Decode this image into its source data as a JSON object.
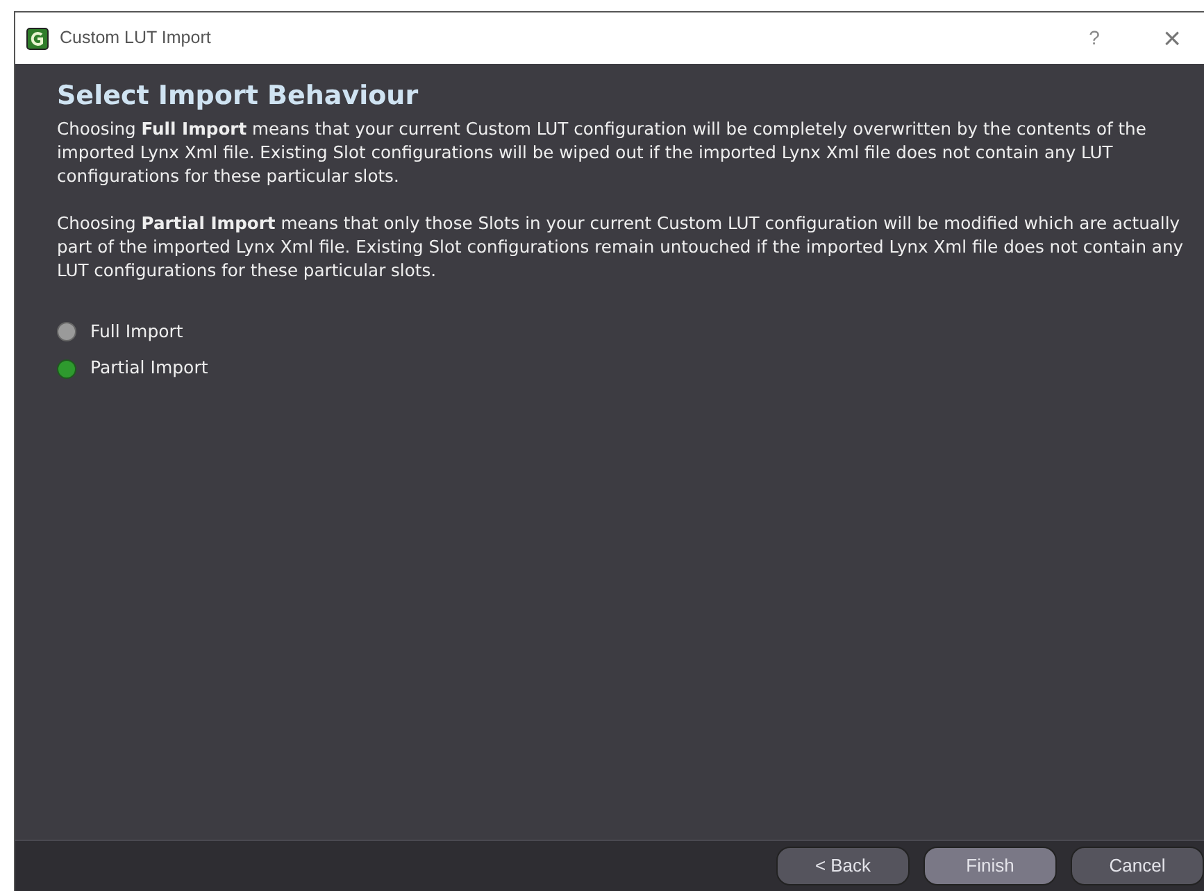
{
  "window": {
    "title": "Custom LUT Import",
    "help": "?",
    "close": "×"
  },
  "heading": "Select Import Behaviour",
  "paragraphs": [
    "Choosing **Full Import** means that your current Custom LUT configuration will be completely overwritten by the contents of the imported Lynx Xml file. Existing Slot configurations will be wiped out if the imported Lynx Xml file does not contain any LUT configurations for these particular slots.",
    "Choosing **Partial Import** means that only those Slots in your current Custom LUT configuration will be modified which are actually part of the imported Lynx Xml file. Existing Slot configurations remain untouched if the imported Lynx Xml file does not contain any LUT configurations for these particular slots."
  ],
  "options": [
    {
      "label": "Full Import",
      "selected": false
    },
    {
      "label": "Partial Import",
      "selected": true
    }
  ],
  "buttons": [
    {
      "label": "< Back",
      "selected": false
    },
    {
      "label": "Finish",
      "selected": true
    },
    {
      "label": "Cancel",
      "selected": false
    }
  ]
}
